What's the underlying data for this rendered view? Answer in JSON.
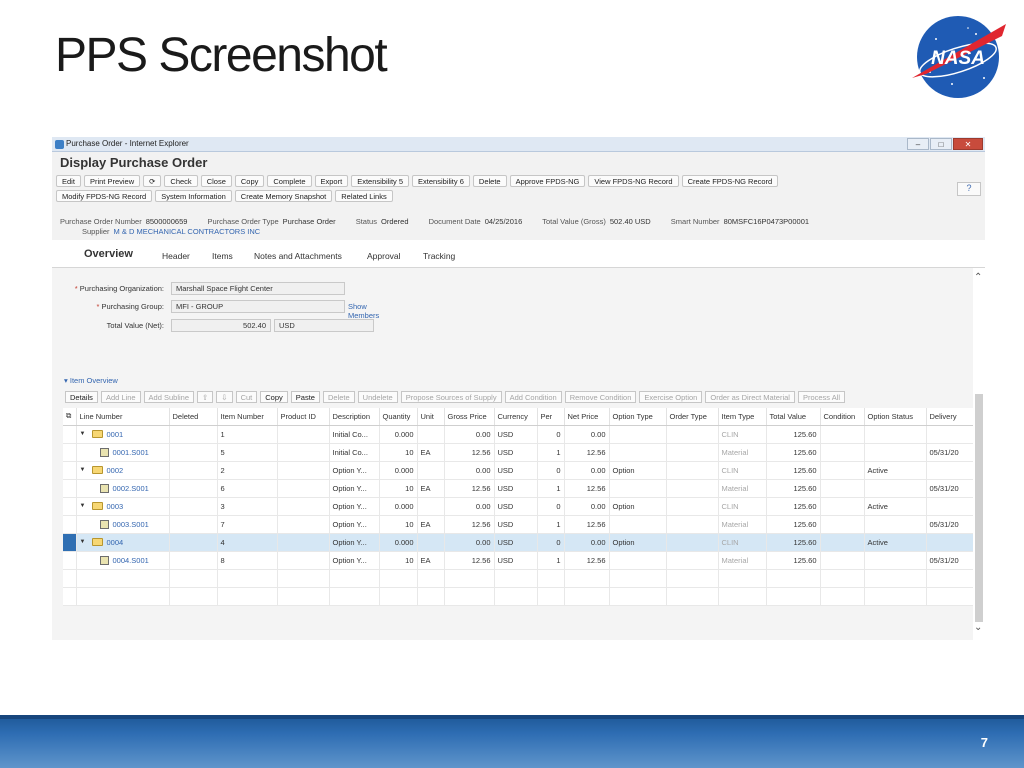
{
  "slide": {
    "title": "PPS Screenshot",
    "page_number": "7",
    "logo": "NASA"
  },
  "browser": {
    "window_title": "Purchase Order - Internet Explorer",
    "minimize": "–",
    "maximize": "□",
    "close": "✕"
  },
  "app": {
    "heading": "Display Purchase Order",
    "toolbar_row1": [
      "Edit",
      "Print Preview",
      "⟳",
      "Check",
      "Close",
      "Copy",
      "Complete",
      "Export",
      "Extensibility 5",
      "Extensibility 6",
      "Delete",
      "Approve FPDS-NG",
      "View FPDS-NG Record",
      "Create FPDS-NG Record"
    ],
    "toolbar_row2": [
      "Modify FPDS-NG Record",
      "System Information",
      "Create Memory Snapshot",
      "Related Links"
    ],
    "help": "?",
    "header_info": {
      "po_number_label": "Purchase Order Number",
      "po_number": "8500000659",
      "po_type_label": "Purchase Order Type",
      "po_type": "Purchase Order",
      "status_label": "Status",
      "status": "Ordered",
      "doc_date_label": "Document Date",
      "doc_date": "04/25/2016",
      "total_label": "Total Value (Gross)",
      "total": "502.40 USD",
      "smart_label": "Smart Number",
      "smart": "80MSFC16P0473P00001",
      "supplier_label": "Supplier",
      "supplier": "M & D MECHANICAL CONTRACTORS INC"
    },
    "tabs": [
      "Overview",
      "Header",
      "Items",
      "Notes and Attachments",
      "Approval",
      "Tracking"
    ]
  },
  "overview": {
    "purch_org_label": "Purchasing Organization:",
    "purch_org_value": "Marshall Space Flight Center",
    "purch_group_label": "Purchasing Group:",
    "purch_group_value": "MFI - GROUP",
    "show_members": "Show Members",
    "total_net_label": "Total Value (Net):",
    "total_net_value": "502.40",
    "total_net_currency": "USD"
  },
  "item_overview": {
    "title": "Item Overview",
    "toolbar": [
      {
        "label": "Details",
        "enabled": true
      },
      {
        "label": "Add Line",
        "enabled": false
      },
      {
        "label": "Add Subline",
        "enabled": false
      },
      {
        "label": "⇧",
        "enabled": false
      },
      {
        "label": "⇩",
        "enabled": false
      },
      {
        "label": "Cut",
        "enabled": false
      },
      {
        "label": "Copy",
        "enabled": true
      },
      {
        "label": "Paste",
        "enabled": true
      },
      {
        "label": "Delete",
        "enabled": false
      },
      {
        "label": "Undelete",
        "enabled": false
      },
      {
        "label": "Propose Sources of Supply",
        "enabled": false
      },
      {
        "label": "Add Condition",
        "enabled": false
      },
      {
        "label": "Remove Condition",
        "enabled": false
      },
      {
        "label": "Exercise Option",
        "enabled": false
      },
      {
        "label": "Order as Direct Material",
        "enabled": false
      },
      {
        "label": "Process All",
        "enabled": false
      }
    ],
    "columns": [
      "Line Number",
      "Deleted",
      "Item Number",
      "Product ID",
      "Description",
      "Quantity",
      "Unit",
      "Gross Price",
      "Currency",
      "Per",
      "Net Price",
      "Option Type",
      "Order Type",
      "Item Type",
      "Total Value",
      "Condition",
      "Option Status",
      "Delivery"
    ],
    "rows": [
      {
        "level": 0,
        "line": "0001",
        "item": "1",
        "desc": "Initial Co...",
        "qty": "0.000",
        "unit": "",
        "gross": "0.00",
        "cur": "USD",
        "per": "0",
        "net": "0.00",
        "opt": "",
        "itype": "CLIN",
        "total": "125.60",
        "ostatus": "",
        "delivery": "",
        "selected": false
      },
      {
        "level": 1,
        "line": "0001.S001",
        "item": "5",
        "desc": "Initial Co...",
        "qty": "10",
        "unit": "EA",
        "gross": "12.56",
        "cur": "USD",
        "per": "1",
        "net": "12.56",
        "opt": "",
        "itype": "Material",
        "total": "125.60",
        "ostatus": "",
        "delivery": "05/31/20",
        "selected": false
      },
      {
        "level": 0,
        "line": "0002",
        "item": "2",
        "desc": "Option Y...",
        "qty": "0.000",
        "unit": "",
        "gross": "0.00",
        "cur": "USD",
        "per": "0",
        "net": "0.00",
        "opt": "Option",
        "itype": "CLIN",
        "total": "125.60",
        "ostatus": "Active",
        "delivery": "",
        "selected": false
      },
      {
        "level": 1,
        "line": "0002.S001",
        "item": "6",
        "desc": "Option Y...",
        "qty": "10",
        "unit": "EA",
        "gross": "12.56",
        "cur": "USD",
        "per": "1",
        "net": "12.56",
        "opt": "",
        "itype": "Material",
        "total": "125.60",
        "ostatus": "",
        "delivery": "05/31/20",
        "selected": false
      },
      {
        "level": 0,
        "line": "0003",
        "item": "3",
        "desc": "Option Y...",
        "qty": "0.000",
        "unit": "",
        "gross": "0.00",
        "cur": "USD",
        "per": "0",
        "net": "0.00",
        "opt": "Option",
        "itype": "CLIN",
        "total": "125.60",
        "ostatus": "Active",
        "delivery": "",
        "selected": false
      },
      {
        "level": 1,
        "line": "0003.S001",
        "item": "7",
        "desc": "Option Y...",
        "qty": "10",
        "unit": "EA",
        "gross": "12.56",
        "cur": "USD",
        "per": "1",
        "net": "12.56",
        "opt": "",
        "itype": "Material",
        "total": "125.60",
        "ostatus": "",
        "delivery": "05/31/20",
        "selected": false
      },
      {
        "level": 0,
        "line": "0004",
        "item": "4",
        "desc": "Option Y...",
        "qty": "0.000",
        "unit": "",
        "gross": "0.00",
        "cur": "USD",
        "per": "0",
        "net": "0.00",
        "opt": "Option",
        "itype": "CLIN",
        "total": "125.60",
        "ostatus": "Active",
        "delivery": "",
        "selected": true
      },
      {
        "level": 1,
        "line": "0004.S001",
        "item": "8",
        "desc": "Option Y...",
        "qty": "10",
        "unit": "EA",
        "gross": "12.56",
        "cur": "USD",
        "per": "1",
        "net": "12.56",
        "opt": "",
        "itype": "Material",
        "total": "125.60",
        "ostatus": "",
        "delivery": "05/31/20",
        "selected": false
      }
    ],
    "empty_rows": 2
  },
  "colors": {
    "link": "#3466b0",
    "selection": "#d5e7f5",
    "footer": "#2e6db3"
  }
}
